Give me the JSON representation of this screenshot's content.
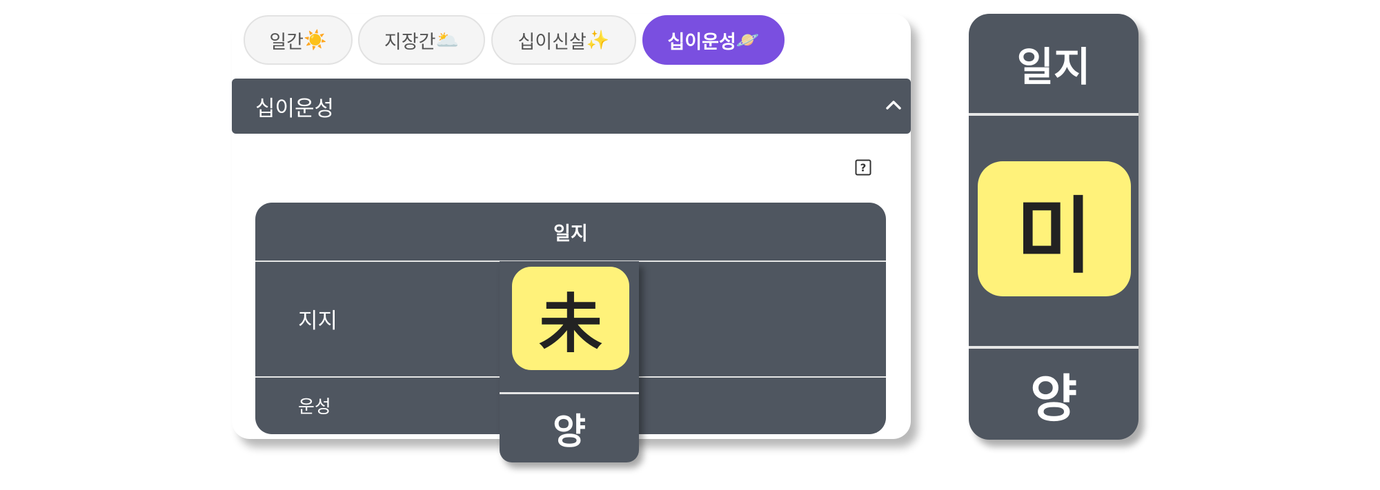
{
  "tabs": [
    {
      "label": "일간",
      "emoji": "☀️",
      "active": false
    },
    {
      "label": "지장간",
      "emoji": "🌥️",
      "active": false
    },
    {
      "label": "십이신살",
      "emoji": "✨",
      "active": false
    },
    {
      "label": "십이운성",
      "emoji": "🪐",
      "active": true
    }
  ],
  "accordion": {
    "title": "십이운성",
    "icon": "chevron-up-icon"
  },
  "help": {
    "icon": "question-icon"
  },
  "table": {
    "column_header": "일지",
    "row_jiji_label": "지지",
    "row_unseong_label": "운성",
    "jiji_value": "未",
    "unseong_value": "양"
  },
  "zoom": {
    "header": "일지",
    "value": "미",
    "unseong_value": "양"
  },
  "colors": {
    "active_tab": "#7a4fe0",
    "panel": "#4f5660",
    "highlight": "#fff27a"
  }
}
